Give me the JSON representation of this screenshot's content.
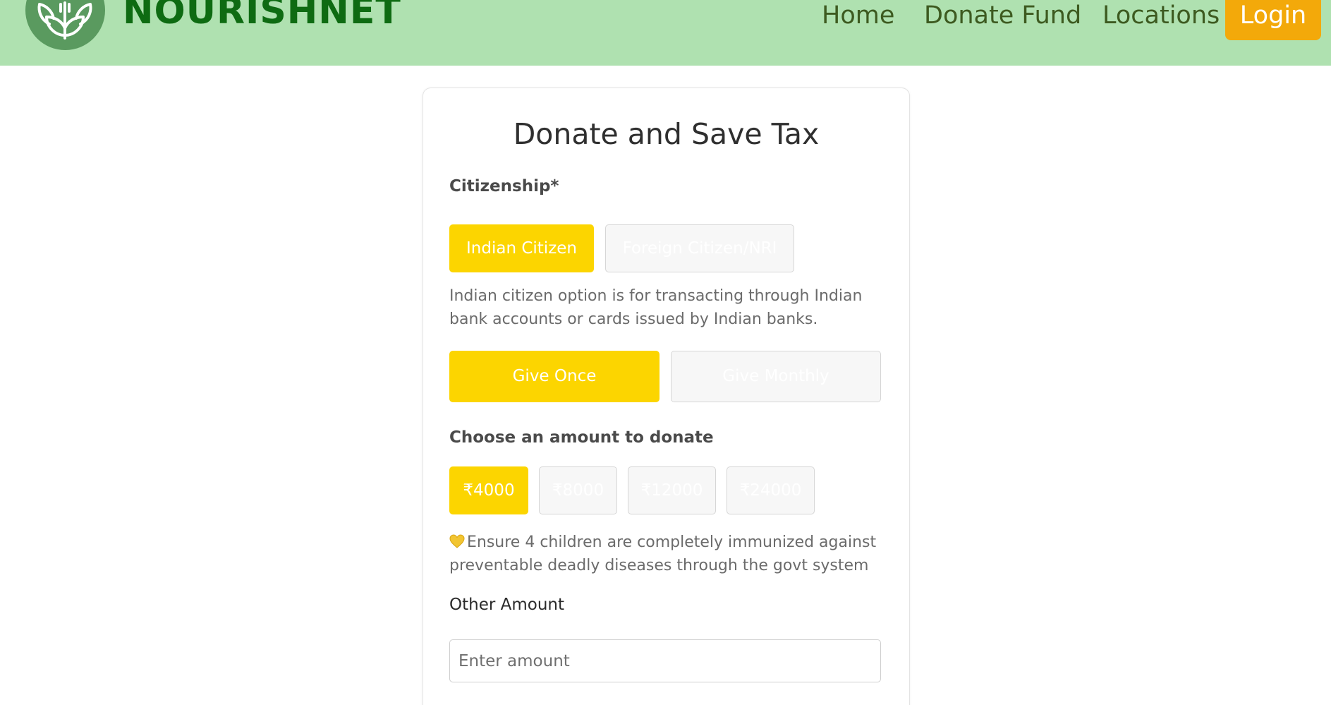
{
  "navbar": {
    "brand": "NOURISHNET",
    "links": [
      "Home",
      "Donate Fund",
      "Locations"
    ],
    "login_label": "Login",
    "logo_icon": "leaf-fork-logo-icon"
  },
  "form": {
    "title": "Donate and Save Tax",
    "citizenship": {
      "label": "Citizenship*",
      "options": [
        "Indian Citizen",
        "Foreign Citizen/NRI"
      ],
      "selected": "Indian Citizen",
      "help": "Indian citizen option is for transacting through Indian bank accounts or cards issued by Indian banks."
    },
    "frequency": {
      "options": [
        "Give Once",
        "Give Monthly"
      ],
      "selected": "Give Once"
    },
    "amount": {
      "label": "Choose an amount to donate",
      "options": [
        "₹4000",
        "₹8000",
        "₹12000",
        "₹24000"
      ],
      "selected": "₹4000",
      "impact_icon": "yellow-heart-icon",
      "impact_text": "Ensure 4 children are completely immunized against preventable deadly diseases through the govt system"
    },
    "other_amount": {
      "label": "Other Amount",
      "placeholder": "Enter amount",
      "value": ""
    }
  },
  "colors": {
    "navbar_bg": "#afe1b0",
    "brand": "#0e6b12",
    "login_bg": "#f3a90a",
    "selected_option": "#fcd500",
    "unselected_option": "#f7f7f7"
  }
}
